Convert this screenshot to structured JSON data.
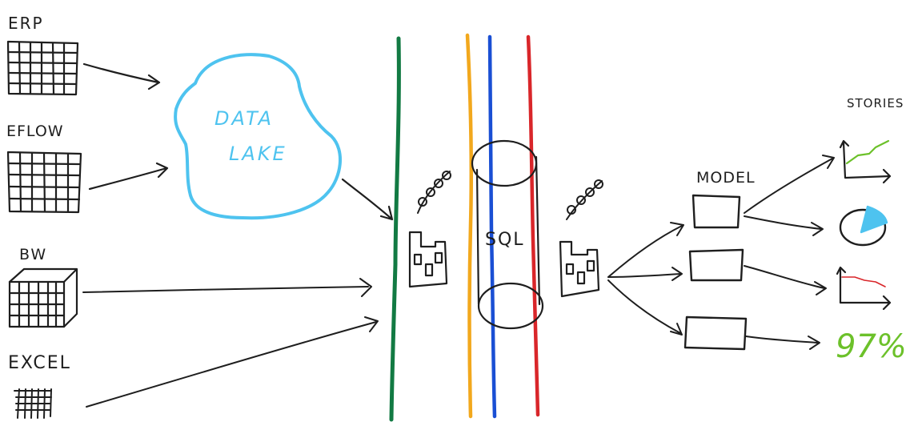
{
  "sources": {
    "erp_label": "ERP",
    "eflow_label": "EFLOW",
    "bw_label": "BW",
    "excel_label": "EXCEL"
  },
  "data_lake": {
    "label_line1": "DATA",
    "label_line2": "LAKE",
    "color": "#4ec3ef"
  },
  "database": {
    "label": "SQL"
  },
  "model": {
    "label": "MODEL"
  },
  "stories": {
    "label": "STORIES",
    "kpi_value": "97%",
    "kpi_color": "#6cc12a"
  },
  "layers": {
    "colors": [
      "#127a43",
      "#f2a81d",
      "#1a4fd4",
      "#d9262a"
    ]
  },
  "ink_color": "#1e1e1e",
  "icons": [
    "table-icon",
    "cube-icon",
    "cloud-icon",
    "cylinder-icon",
    "factory-icon",
    "key-icon",
    "box-icon",
    "line-chart-icon",
    "pie-chart-icon",
    "area-chart-icon"
  ]
}
